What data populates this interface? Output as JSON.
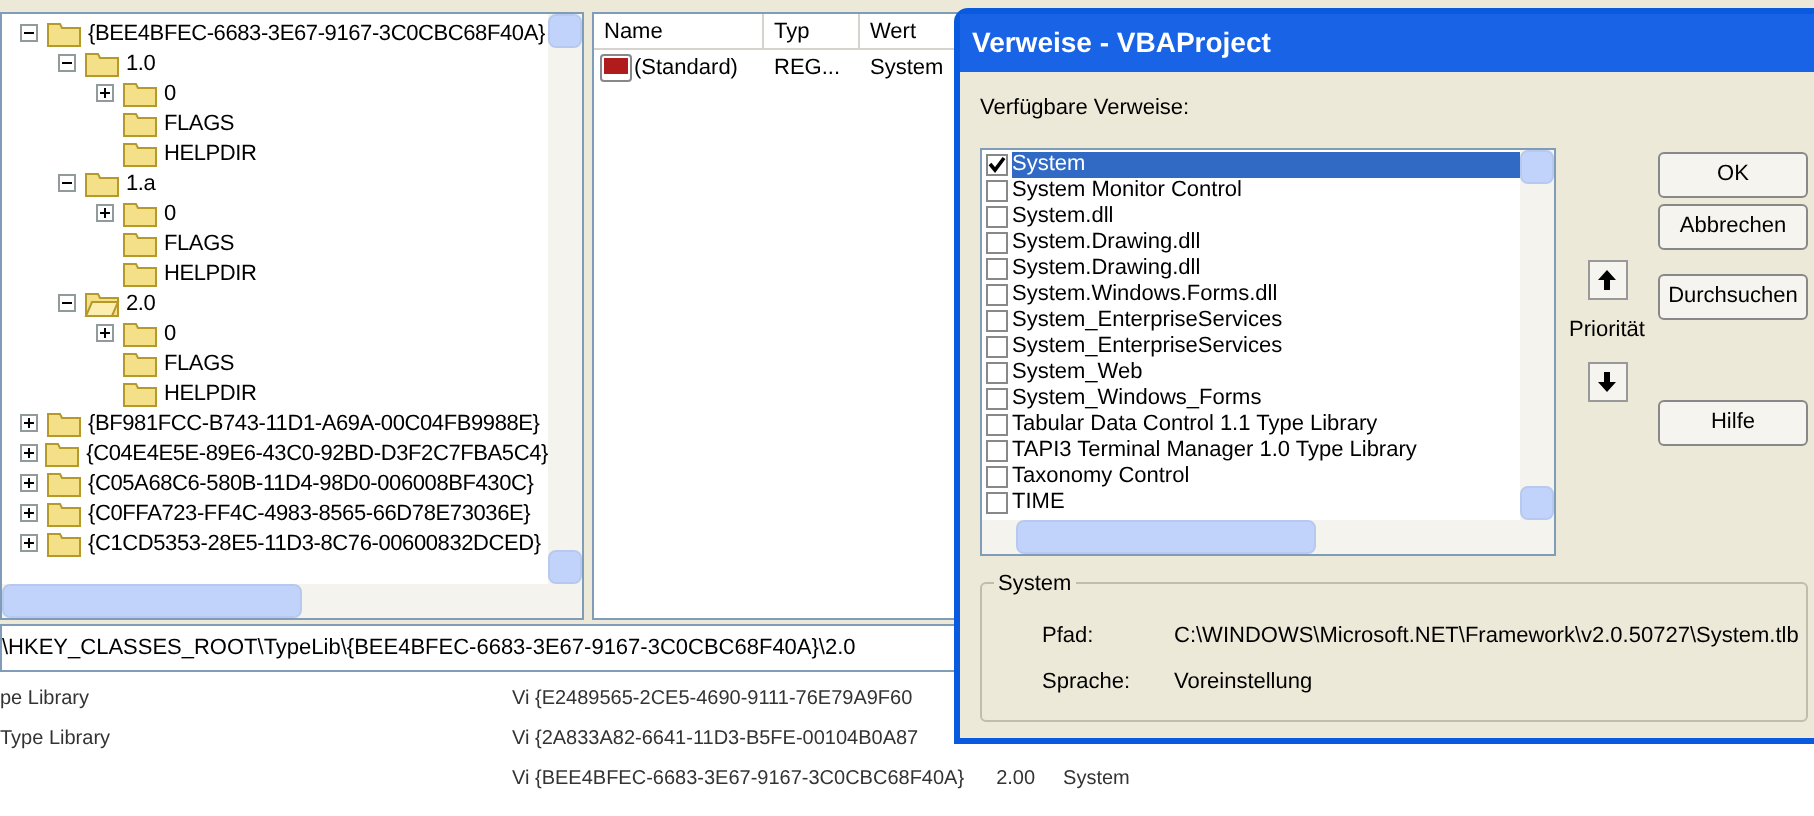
{
  "tree": [
    {
      "label": "{BEE4BFEC-6683-3E67-9167-3C0CBC68F40A}",
      "expanded": true,
      "selected": false,
      "children": [
        {
          "label": "1.0",
          "expanded": true,
          "selected": false,
          "children": [
            {
              "label": "0",
              "expanded": false,
              "selected": false
            },
            {
              "label": "FLAGS",
              "selected": false
            },
            {
              "label": "HELPDIR",
              "selected": false
            }
          ]
        },
        {
          "label": "1.a",
          "expanded": true,
          "selected": false,
          "children": [
            {
              "label": "0",
              "expanded": false,
              "selected": false
            },
            {
              "label": "FLAGS",
              "selected": false
            },
            {
              "label": "HELPDIR",
              "selected": false
            }
          ]
        },
        {
          "label": "2.0",
          "expanded": true,
          "selected": true,
          "children": [
            {
              "label": "0",
              "expanded": false,
              "selected": false
            },
            {
              "label": "FLAGS",
              "selected": false
            },
            {
              "label": "HELPDIR",
              "selected": false
            }
          ]
        }
      ]
    },
    {
      "label": "{BF981FCC-B743-11D1-A69A-00C04FB9988E}",
      "expanded": false,
      "selected": false
    },
    {
      "label": "{C04E4E5E-89E6-43C0-92BD-D3F2C7FBA5C4}",
      "expanded": false,
      "selected": false
    },
    {
      "label": "{C05A68C6-580B-11D4-98D0-006008BF430C}",
      "expanded": false,
      "selected": false
    },
    {
      "label": "{C0FFA723-FF4C-4983-8565-66D78E73036E}",
      "expanded": false,
      "selected": false
    },
    {
      "label": "{C1CD5353-28E5-11D3-8C76-00600832DCED}",
      "expanded": false,
      "selected": false
    }
  ],
  "values_list": {
    "columns": [
      "Name",
      "Typ",
      "Wert"
    ],
    "rows": [
      {
        "name": "(Standard)",
        "type": "REG...",
        "value": "System"
      }
    ]
  },
  "address_bar": "\\HKEY_CLASSES_ROOT\\TypeLib\\{BEE4BFEC-6683-3E67-9167-3C0CBC68F40A}\\2.0",
  "background_list": [
    {
      "name": "pe Library",
      "id": "Vi {E2489565-2CE5-4690-9111-76E79A9F60"
    },
    {
      "name": "Type Library",
      "id": "Vi {2A833A82-6641-11D3-B5FE-00104B0A87"
    },
    {
      "id": "Vi {BEE4BFEC-6683-3E67-9167-3C0CBC68F40A}",
      "version": "2.00",
      "description": "System"
    }
  ],
  "dialog": {
    "title": "Verweise - VBAProject",
    "list_label": "Verfügbare Verweise:",
    "references": [
      {
        "label": "System",
        "checked": true,
        "selected": true
      },
      {
        "label": "System Monitor Control",
        "checked": false,
        "selected": false
      },
      {
        "label": "System.dll",
        "checked": false,
        "selected": false
      },
      {
        "label": "System.Drawing.dll",
        "checked": false,
        "selected": false
      },
      {
        "label": "System.Drawing.dll",
        "checked": false,
        "selected": false
      },
      {
        "label": "System.Windows.Forms.dll",
        "checked": false,
        "selected": false
      },
      {
        "label": "System_EnterpriseServices",
        "checked": false,
        "selected": false
      },
      {
        "label": "System_EnterpriseServices",
        "checked": false,
        "selected": false
      },
      {
        "label": "System_Web",
        "checked": false,
        "selected": false
      },
      {
        "label": "System_Windows_Forms",
        "checked": false,
        "selected": false
      },
      {
        "label": "Tabular Data Control 1.1 Type Library",
        "checked": false,
        "selected": false
      },
      {
        "label": "TAPI3 Terminal Manager 1.0 Type Library",
        "checked": false,
        "selected": false
      },
      {
        "label": "Taxonomy Control",
        "checked": false,
        "selected": false
      },
      {
        "label": "TIME",
        "checked": false,
        "selected": false
      }
    ],
    "buttons": [
      "OK",
      "Abbrechen",
      "Durchsuchen",
      "Hilfe"
    ],
    "priority_label": "Priorität",
    "details": {
      "title": "System",
      "path_label": "Pfad:",
      "path": "C:\\WINDOWS\\Microsoft.NET\\Framework\\v2.0.50727\\System.tlb",
      "language_label": "Sprache:",
      "language": "Voreinstellung"
    }
  }
}
